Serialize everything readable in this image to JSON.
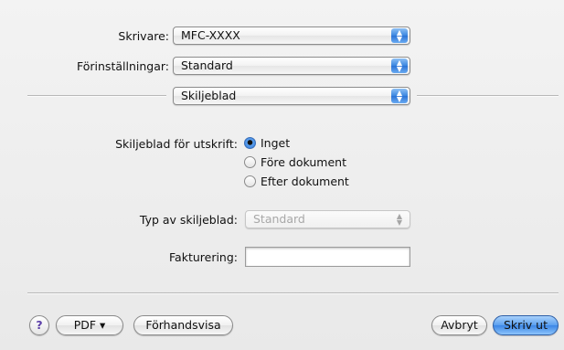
{
  "printer": {
    "label": "Skrivare:",
    "value": "MFC-XXXX"
  },
  "presets": {
    "label": "Förinställningar:",
    "value": "Standard"
  },
  "panel": {
    "value": "Skiljeblad"
  },
  "separator_sheet": {
    "label": "Skiljeblad för utskrift:",
    "options": [
      "Inget",
      "Före dokument",
      "Efter dokument"
    ],
    "selected": "Inget"
  },
  "separator_type": {
    "label": "Typ av skiljeblad:",
    "value": "Standard",
    "enabled": false
  },
  "billing": {
    "label": "Fakturering:",
    "value": ""
  },
  "footer": {
    "help": "?",
    "pdf_label": "PDF ▾",
    "preview_label": "Förhandsvisa",
    "cancel_label": "Avbryt",
    "print_label": "Skriv ut"
  },
  "colors": {
    "accent": "#3b86e6"
  },
  "icons": {
    "popup_arrows": "up-down-arrows-icon",
    "radio_selected": "radio-selected-icon"
  }
}
